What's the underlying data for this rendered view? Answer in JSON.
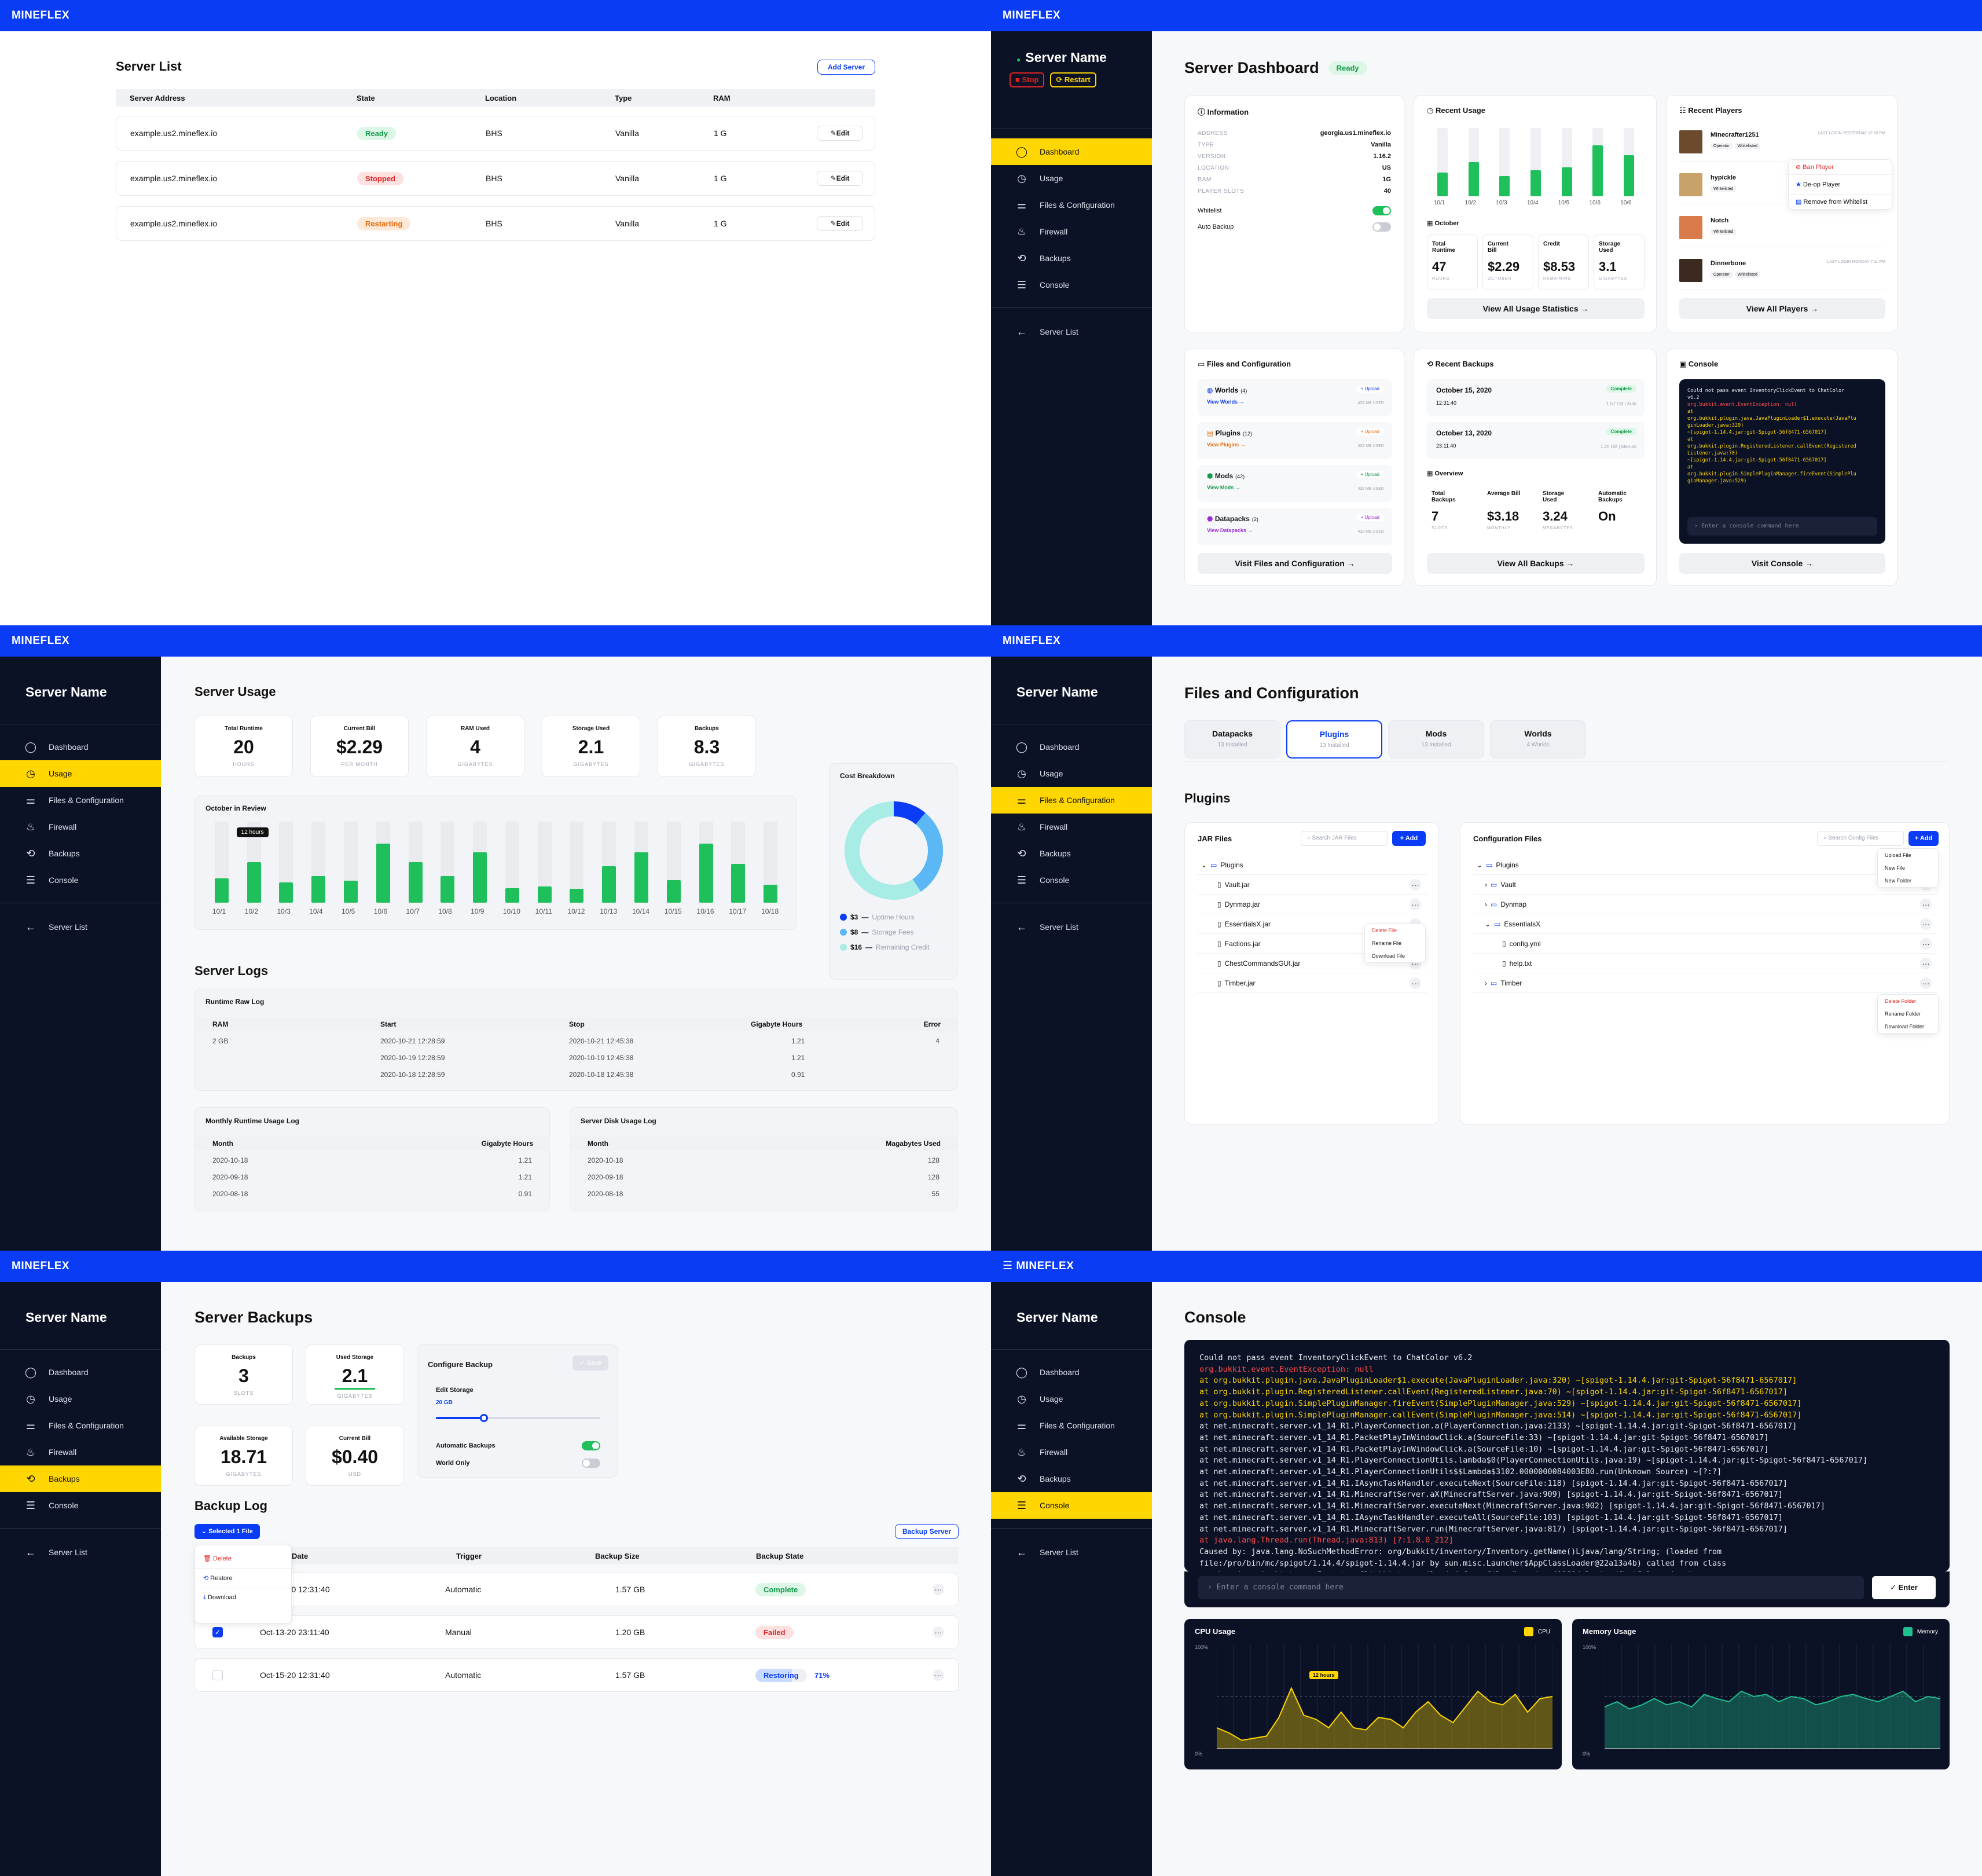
{
  "brand": "MINEFLEX",
  "server_name": "Server Name",
  "nav": {
    "dashboard": "Dashboard",
    "usage": "Usage",
    "files": "Files & Configuration",
    "firewall": "Firewall",
    "backups": "Backups",
    "console": "Console",
    "server_list": "Server List"
  },
  "controls": {
    "stop": "Stop",
    "restart": "Restart"
  },
  "server_list": {
    "title": "Server List",
    "add_button": "Add Server",
    "headers": [
      "Server Address",
      "State",
      "Location",
      "Type",
      "RAM"
    ],
    "rows": [
      {
        "address": "example.us2.mineflex.io",
        "state": "Ready",
        "location": "BHS",
        "type": "Vanilla",
        "ram": "1 G"
      },
      {
        "address": "example.us2.mineflex.io",
        "state": "Stopped",
        "location": "BHS",
        "type": "Vanilla",
        "ram": "1 G"
      },
      {
        "address": "example.us2.mineflex.io",
        "state": "Restarting",
        "location": "BHS",
        "type": "Vanilla",
        "ram": "1 G"
      }
    ],
    "edit_label": "Edit"
  },
  "dashboard": {
    "title": "Server Dashboard",
    "status": "Ready",
    "info": {
      "title": "Information",
      "rows": [
        {
          "k": "ADDRESS",
          "v": "georgia.us1.mineflex.io"
        },
        {
          "k": "TYPE",
          "v": "Vanilla"
        },
        {
          "k": "VERSION",
          "v": "1.16.2"
        },
        {
          "k": "LOCATION",
          "v": "US"
        },
        {
          "k": "RAM",
          "v": "1G"
        },
        {
          "k": "PLAYER SLOTS",
          "v": "40"
        }
      ],
      "whitelist": "Whitelist",
      "auto_backup": "Auto Backup"
    },
    "usage": {
      "title": "Recent Usage",
      "labels": [
        "10/1",
        "10/2",
        "10/3",
        "10/4",
        "10/5",
        "10/6",
        "10/6"
      ],
      "values": [
        0.35,
        0.5,
        0.3,
        0.38,
        0.42,
        0.75,
        0.6
      ],
      "month": "October",
      "stats": [
        {
          "l": "Total Runtime",
          "v": "47",
          "u": "HOURS"
        },
        {
          "l": "Current Bill",
          "v": "$2.29",
          "u": "OCTOBER"
        },
        {
          "l": "Credit",
          "v": "$8.53",
          "u": "REMAINING"
        },
        {
          "l": "Storage Used",
          "v": "3.1",
          "u": "GIGABYTES"
        }
      ],
      "button": "View All Usage Statistics →"
    },
    "players": {
      "title": "Recent Players",
      "list": [
        {
          "name": "Minecrafter1251",
          "tags": [
            "Operator",
            "Whitelisted"
          ],
          "last": "LAST LOGIN YESTERDAY 12:55 PM"
        },
        {
          "name": "hypickle",
          "tags": [
            "Whitelisted"
          ],
          "last": ""
        },
        {
          "name": "Notch",
          "tags": [
            "Whitelisted"
          ],
          "last": ""
        },
        {
          "name": "Dinnerbone",
          "tags": [
            "Operator",
            "Whitelisted"
          ],
          "last": "LAST LOGIN MONDAY 7:11 PM"
        }
      ],
      "menu": [
        "Ban Player",
        "De-op Player",
        "Remove from Whitelist"
      ],
      "button": "View All Players →"
    },
    "files": {
      "title": "Files and Configuration",
      "items": [
        {
          "name": "Worlds",
          "count": "(4)",
          "link": "View Worlds →",
          "size": "432 MB USED"
        },
        {
          "name": "Plugins",
          "count": "(12)",
          "link": "View Plugins →",
          "size": "432 MB USED"
        },
        {
          "name": "Mods",
          "count": "(42)",
          "link": "View Mods →",
          "size": "432 MB USED"
        },
        {
          "name": "Datapacks",
          "count": "(2)",
          "link": "View Datapacks →",
          "size": "432 MB USED"
        }
      ],
      "upload": "+ Upload",
      "button": "Visit Files and Configuration →"
    },
    "backups": {
      "title": "Recent Backups",
      "list": [
        {
          "date": "October 15, 2020",
          "time": "12:31:40",
          "status": "Complete",
          "meta": "1.57 GB | Auto"
        },
        {
          "date": "October 13, 2020",
          "time": "23:11:40",
          "status": "Complete",
          "meta": "1.20 GB | Manual"
        }
      ],
      "overview": "Overview",
      "stats": [
        {
          "l": "Total Backups",
          "v": "7",
          "u": "SLOTS"
        },
        {
          "l": "Average Bill",
          "v": "$3.18",
          "u": "MONTHLY"
        },
        {
          "l": "Storage Used",
          "v": "3.24",
          "u": "MEGABYTES"
        },
        {
          "l": "Automatic Backups",
          "v": "On",
          "u": ""
        }
      ],
      "button": "View All Backups →"
    },
    "console": {
      "title": "Console",
      "placeholder": "Enter a console command here",
      "button": "Visit Console →"
    }
  },
  "usage_page": {
    "title": "Server Usage",
    "stats": [
      {
        "l": "Total Runtime",
        "v": "20",
        "u": "HOURS"
      },
      {
        "l": "Current Bill",
        "v": "$2.29",
        "u": "PER MONTH"
      },
      {
        "l": "RAM Used",
        "v": "4",
        "u": "GIGABYTES"
      },
      {
        "l": "Storage Used",
        "v": "2.1",
        "u": "GIGABYTES"
      },
      {
        "l": "Backups",
        "v": "8.3",
        "u": "GIGABYTES"
      }
    ],
    "review_title": "October in Review",
    "tooltip": "12 hours",
    "cost_title": "Cost Breakdown",
    "legend": [
      {
        "v": "$3",
        "l": "Uptime Hours",
        "c": "#0a3cf5"
      },
      {
        "v": "$8",
        "l": "Storage Fees",
        "c": "#5bb8f5"
      },
      {
        "v": "$16",
        "l": "Remaining Credit",
        "c": "#a8ece6"
      }
    ],
    "logs_title": "Server Logs",
    "raw_log": {
      "title": "Runtime Raw Log",
      "headers": [
        "RAM",
        "Start",
        "Stop",
        "Gigabyte Hours",
        "Error"
      ],
      "rows": [
        [
          "2 GB",
          "2020-10-21 12:28:59",
          "2020-10-21 12:45:38",
          "1.21",
          "4"
        ],
        [
          "",
          "2020-10-19 12:28:59",
          "2020-10-19 12:45:38",
          "1.21",
          ""
        ],
        [
          "",
          "2020-10-18 12:28:59",
          "2020-10-18 12:45:38",
          "0.91",
          ""
        ]
      ]
    },
    "monthly_log": {
      "title": "Monthly Runtime Usage Log",
      "headers": [
        "Month",
        "Gigabyte Hours"
      ],
      "rows": [
        [
          "2020-10-18",
          "1.21"
        ],
        [
          "2020-09-18",
          "1.21"
        ],
        [
          "2020-08-18",
          "0.91"
        ]
      ]
    },
    "disk_log": {
      "title": "Server Disk Usage Log",
      "headers": [
        "Month",
        "Magabytes Used"
      ],
      "rows": [
        [
          "2020-10-18",
          "128"
        ],
        [
          "2020-09-18",
          "128"
        ],
        [
          "2020-08-18",
          "55"
        ]
      ]
    }
  },
  "files_page": {
    "title": "Files and Configuration",
    "tabs": [
      {
        "t": "Datapacks",
        "s": "13 Installed"
      },
      {
        "t": "Plugins",
        "s": "13 Installed"
      },
      {
        "t": "Mods",
        "s": "13 Installed"
      },
      {
        "t": "Worlds",
        "s": "4 Worlds"
      }
    ],
    "section": "Plugins",
    "jar": {
      "title": "JAR Files",
      "search": "Search JAR Files",
      "add": "+ Add",
      "folder": "Plugins",
      "files": [
        "Vault.jar",
        "Dynmap.jar",
        "EssentialsX.jar",
        "Factions.jar",
        "ChestCommandsGUI.jar",
        "Timber.jar"
      ],
      "menu": [
        "Delete File",
        "Rename File",
        "Download File"
      ]
    },
    "config": {
      "title": "Configuration Files",
      "search": "Search Config Files",
      "add": "+ Add",
      "folder": "Plugins",
      "items": [
        "Vault",
        "Dynmap",
        "EssentialsX",
        "config.yml",
        "help.txt",
        "Timber"
      ],
      "menu1": [
        "Upload File",
        "New File",
        "New Folder"
      ],
      "menu2": [
        "Delete Folder",
        "Rename Folder",
        "Download Folder"
      ]
    }
  },
  "backups_page": {
    "title": "Server Backups",
    "stats": [
      {
        "l": "Backups",
        "v": "3",
        "u": "SLOTS"
      },
      {
        "l": "Used Storage",
        "v": "2.1",
        "u": "GIGABYTES"
      },
      {
        "l": "Available Storage",
        "v": "18.71",
        "u": "GIGABYTES"
      },
      {
        "l": "Current Bill",
        "v": "$0.40",
        "u": "USD"
      }
    ],
    "configure": {
      "title": "Configure Backup",
      "save": "Save",
      "edit_storage": "Edit Storage",
      "storage_value": "20 GB",
      "auto": "Automatic Backups",
      "world_only": "World Only"
    },
    "log_title": "Backup Log",
    "selected": "Selected 1 File",
    "backup_button": "Backup Server",
    "menu": [
      "Delete",
      "Restore",
      "Download"
    ],
    "headers": [
      "Date",
      "Trigger",
      "Backup Size",
      "Backup State"
    ],
    "rows": [
      {
        "date": "Oct-15-20 12:31:40",
        "trigger": "Automatic",
        "size": "1.57 GB",
        "state": "Complete"
      },
      {
        "date": "Oct-13-20 23:11:40",
        "trigger": "Manual",
        "size": "1.20 GB",
        "state": "Failed"
      },
      {
        "date": "Oct-15-20 12:31:40",
        "trigger": "Automatic",
        "size": "1.57 GB",
        "state": "Restoring",
        "pct": "71%"
      }
    ]
  },
  "console_page": {
    "title": "Console",
    "placeholder": "Enter a console command here",
    "enter": "Enter",
    "cpu": {
      "title": "CPU Usage",
      "legend": "CPU",
      "tooltip": "12 hours",
      "ymax": "100%",
      "ymin": "0%"
    },
    "mem": {
      "title": "Memory Usage",
      "legend": "Memory",
      "ymax": "100%",
      "ymin": "0%"
    }
  }
}
